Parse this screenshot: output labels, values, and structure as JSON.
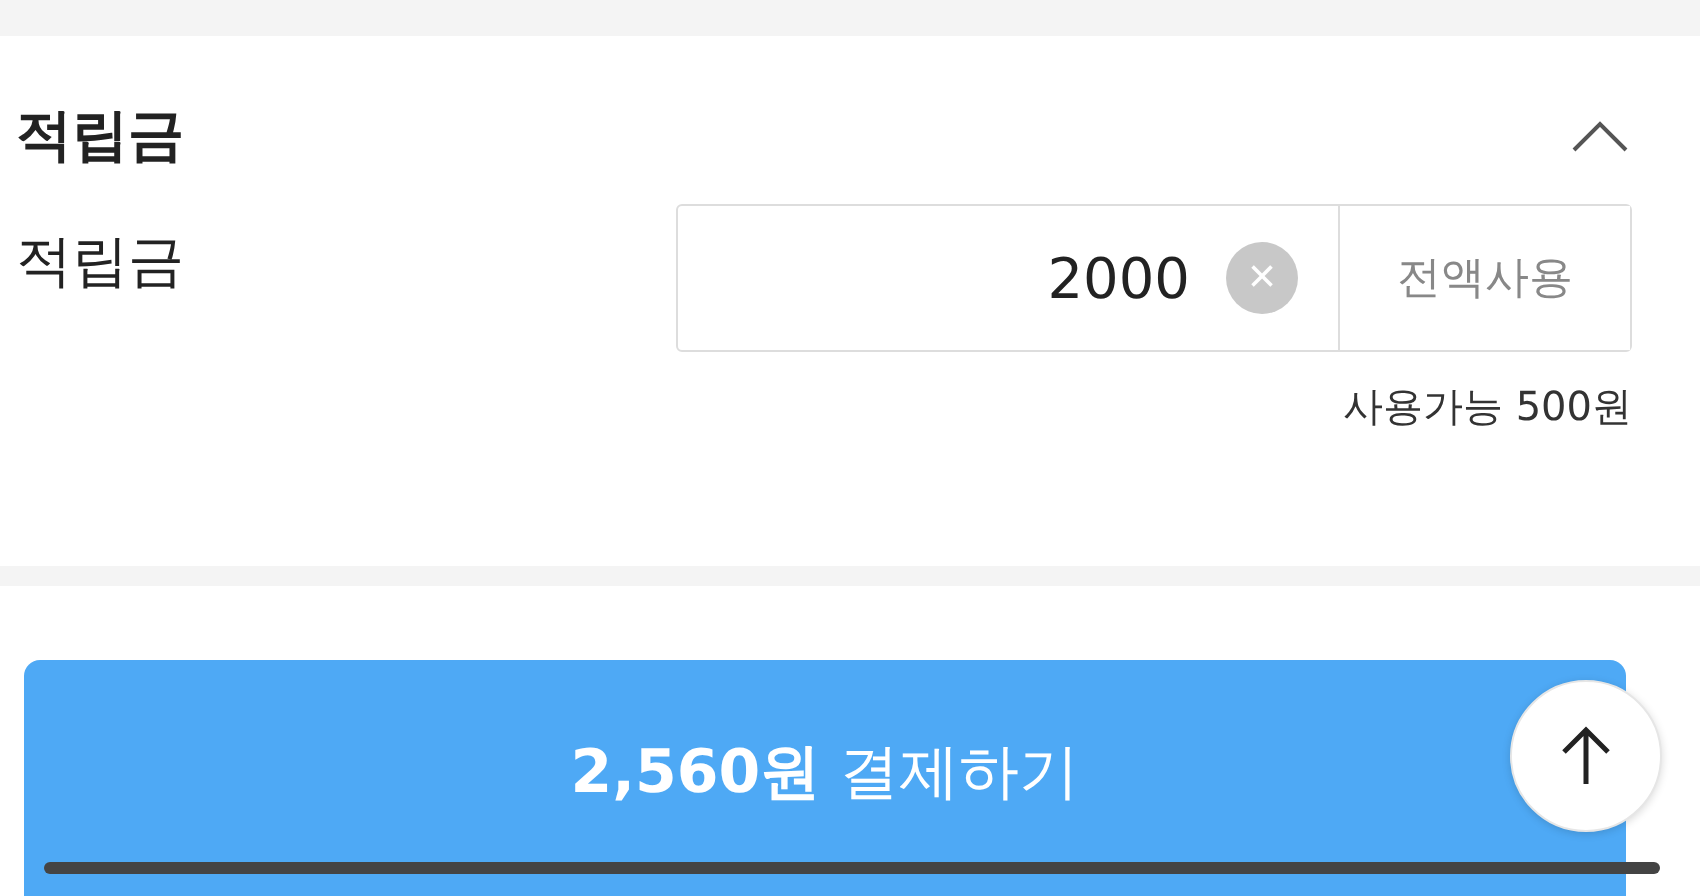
{
  "points_section": {
    "title": "적립금",
    "expanded": true,
    "field_label": "적립금",
    "value": "2000",
    "clear_symbol": "×",
    "use_all_button": "전액사용",
    "available_note": "사용가능 500원"
  },
  "pay_button": {
    "label": "**2,560원** 결제하기"
  }
}
